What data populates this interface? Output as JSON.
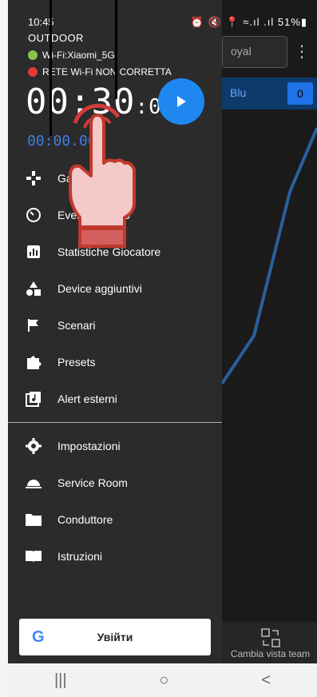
{
  "status_bar": {
    "time": "10:45",
    "icons": "⏰ 🔇 📍 ≈.ıl .ıl 51%▮"
  },
  "header": {
    "mode": "OUTDOOR",
    "wifi_ok": "Wi-Fi:Xiaomi_5G",
    "wifi_err": "RETE Wi-Fi NON CORRETTA",
    "timer_main": "00:30",
    "timer_main_suffix": ":00",
    "timer_secondary": "00:00.00"
  },
  "menu_primary": [
    {
      "label": "Game Room",
      "icon": "gamepad-icon"
    },
    {
      "label": "Eventi di gioco",
      "icon": "timer-icon"
    },
    {
      "label": "Statistiche Giocatore",
      "icon": "stats-icon"
    },
    {
      "label": "Device aggiuntivi",
      "icon": "shapes-icon"
    },
    {
      "label": "Scenari",
      "icon": "flag-icon"
    },
    {
      "label": "Presets",
      "icon": "puzzle-icon"
    },
    {
      "label": "Alert esterni",
      "icon": "music-note-icon"
    }
  ],
  "menu_secondary": [
    {
      "label": "Impostazioni",
      "icon": "gear-icon"
    },
    {
      "label": "Service Room",
      "icon": "cloche-icon"
    },
    {
      "label": "Conduttore",
      "icon": "folder-icon"
    },
    {
      "label": "Istruzioni",
      "icon": "book-icon"
    }
  ],
  "google_signin": {
    "label": "Увійти"
  },
  "background": {
    "team_select": "oyal",
    "team_blue": "Blu",
    "team_blue_score": "0",
    "switch_view": "Cambia vista team"
  },
  "colors": {
    "accent": "#1e88f0",
    "drawer_bg": "#2b2b2b",
    "wifi_ok": "#8bc34a",
    "wifi_err": "#e53935"
  },
  "navbar": {
    "recents": "|||",
    "home": "○",
    "back": "<"
  }
}
